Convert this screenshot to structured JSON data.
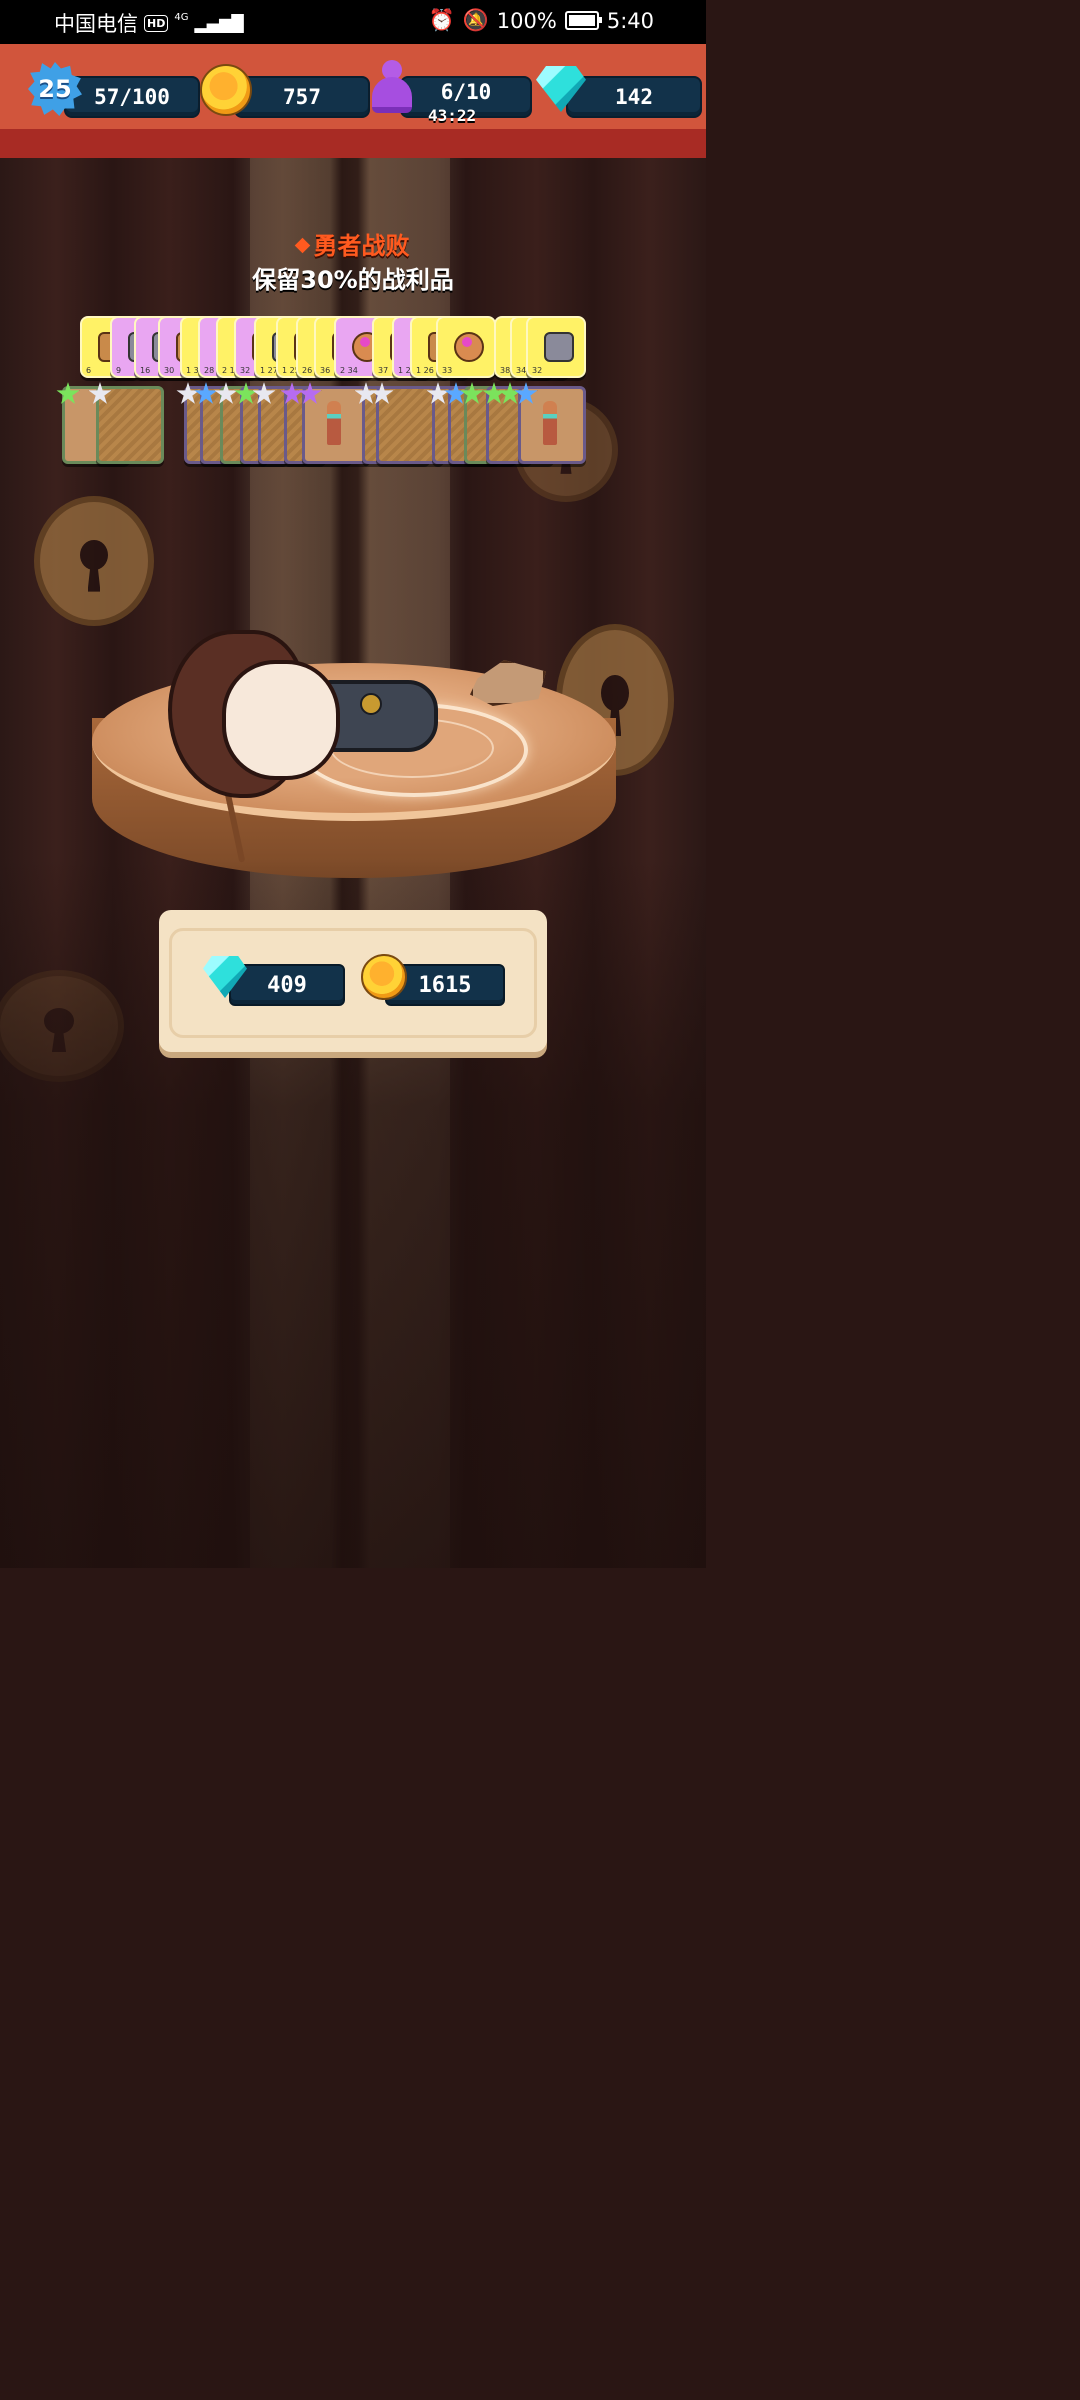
{
  "status_bar": {
    "carrier": "中国电信",
    "hd": "HD",
    "network": "4G",
    "battery_percent": "100%",
    "time": "5:40"
  },
  "hud": {
    "level": "25",
    "xp": "57/100",
    "coins": "757",
    "energy": "6/10",
    "energy_timer": "43:22",
    "gems": "142"
  },
  "result": {
    "title": "勇者战败",
    "subtitle": "保留30%的战利品"
  },
  "loot": {
    "card_numbers": [
      "6",
      "9",
      "16",
      "30",
      "1 30",
      "28",
      "2 1",
      "32",
      "1 27",
      "1 25",
      "26",
      "36",
      "2 34",
      "37",
      "1 29",
      "1 26",
      "33",
      "38",
      "34",
      "32"
    ]
  },
  "rewards": {
    "gems": "409",
    "coins": "1615"
  },
  "colors": {
    "hud_red": "#d1553c",
    "defeat_orange": "#ff5a1f",
    "pill_navy": "#12324a",
    "panel_cream": "#f4e2c4"
  }
}
